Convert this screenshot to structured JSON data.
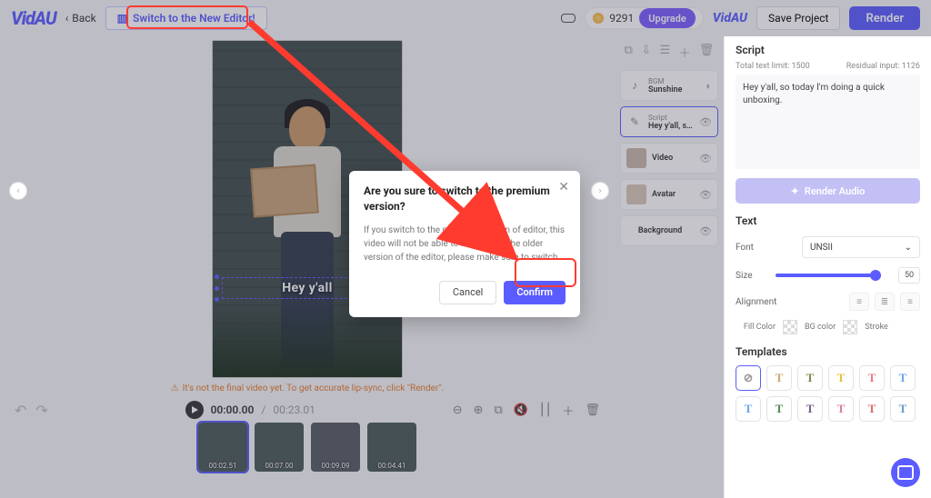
{
  "header": {
    "logo": "VidAU",
    "back": "Back",
    "switch": "Switch to the New Editor!",
    "credits": "9291",
    "upgrade": "Upgrade",
    "minilogo": "VidAU",
    "save": "Save Project",
    "render": "Render"
  },
  "canvas": {
    "subtitle": "Hey y'all",
    "note": "It's not the final video yet. To get accurate lip-sync, click \"Render\".",
    "time_cur": "00:00.00",
    "time_total": "00:23.01"
  },
  "thumbs": [
    {
      "t": "00:02.51"
    },
    {
      "t": "00:07.00"
    },
    {
      "t": "00:09.09"
    },
    {
      "t": "00:04.41"
    }
  ],
  "layers": {
    "bgm": {
      "a": "BGM",
      "b": "Sunshine"
    },
    "script": {
      "a": "Script",
      "b": "Hey y'all, so t…"
    },
    "video": "Video",
    "avatar": "Avatar",
    "background": "Background"
  },
  "right": {
    "script_title": "Script",
    "limit_a": "Total text limit: 1500",
    "limit_b": "Residual input: 1126",
    "script_text": "Hey y'all, so today I'm doing a quick unboxing.",
    "render_audio": "Render Audio",
    "text_title": "Text",
    "font_label": "Font",
    "font_value": "UNSII",
    "size_label": "Size",
    "size_value": "50",
    "align_label": "Alignment",
    "fill": "Fill Color",
    "bg": "BG color",
    "stroke": "Stroke",
    "templates_title": "Templates"
  },
  "templates": [
    {
      "t": "⊘",
      "c": "#999"
    },
    {
      "t": "T",
      "c": "#caa96b"
    },
    {
      "t": "T",
      "c": "#7b8a4e"
    },
    {
      "t": "T",
      "c": "#e3c23b"
    },
    {
      "t": "T",
      "c": "#e77b8a"
    },
    {
      "t": "T",
      "c": "#6aa7e8"
    },
    {
      "t": "T",
      "c": "#6aa7e8"
    },
    {
      "t": "T",
      "c": "#4e8a4e"
    },
    {
      "t": "T",
      "c": "#7a5a8a"
    },
    {
      "t": "T",
      "c": "#d87ba2"
    },
    {
      "t": "T",
      "c": "#d86b6b"
    },
    {
      "t": "T",
      "c": "#6a9acb"
    }
  ],
  "dialog": {
    "title": "Are you sure to switch to the premium version?",
    "body": "If you switch to the premium version of editor, this video will not be able to roll back to the older version of the editor, please make sure to switch.",
    "cancel": "Cancel",
    "confirm": "Confirm"
  }
}
